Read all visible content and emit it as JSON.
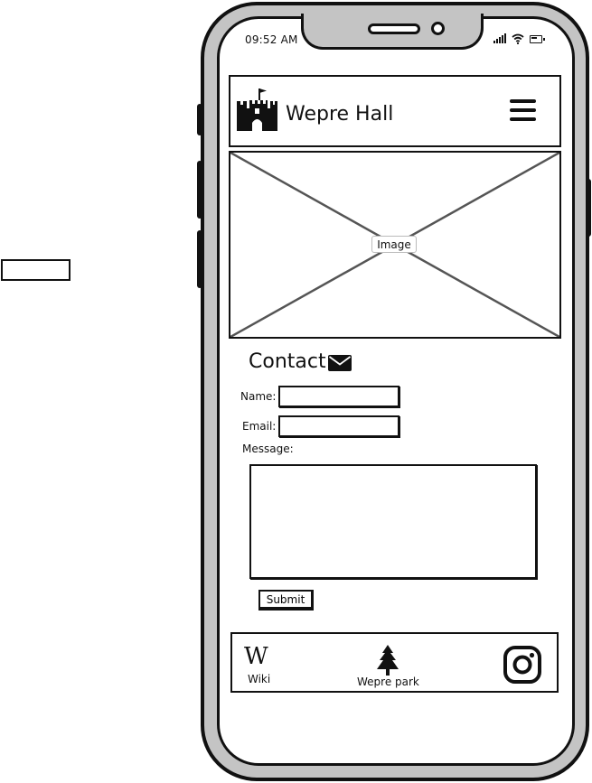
{
  "status_bar": {
    "time": "09:52 AM"
  },
  "header": {
    "title": "Wepre Hall"
  },
  "hero": {
    "placeholder_label": "Image"
  },
  "contact": {
    "title": "Contact",
    "name_label": "Name:",
    "email_label": "Email:",
    "message_label": "Message:",
    "name_value": "",
    "email_value": "",
    "message_value": "",
    "submit_label": "Submit"
  },
  "footer": {
    "wiki_glyph": "W",
    "wiki_label": "Wiki",
    "park_label": "Wepre park"
  },
  "icons": {
    "logo": "castle-icon",
    "menu": "hamburger-menu-icon",
    "contact": "envelope-icon",
    "wiki": "wikipedia-icon",
    "park": "tree-icon",
    "social": "instagram-icon",
    "status": [
      "signal-icon",
      "wifi-icon",
      "battery-icon"
    ]
  },
  "colors": {
    "ink": "#111111",
    "frame": "#c4c4c4",
    "screen": "#ffffff"
  }
}
